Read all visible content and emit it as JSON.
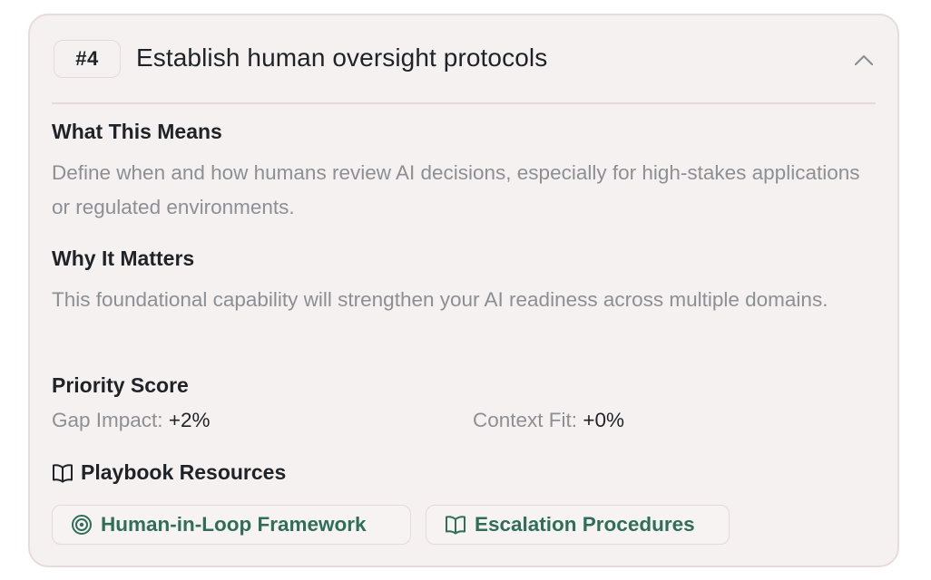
{
  "card": {
    "rank": "#4",
    "title": "Establish human oversight protocols"
  },
  "what_this_means": {
    "heading": "What This Means",
    "body": "Define when and how humans review AI decisions, especially for high-stakes applications or regulated environments."
  },
  "why_it_matters": {
    "heading": "Why It Matters",
    "body": "This foundational capability will strengthen your AI readiness across multiple domains."
  },
  "priority_score": {
    "heading": "Priority Score",
    "gap_impact_label": "Gap Impact:",
    "gap_impact_value": "+2%",
    "context_fit_label": "Context Fit:",
    "context_fit_value": "+0%"
  },
  "playbook": {
    "heading": "Playbook Resources",
    "icon": "book-open-icon",
    "resources": [
      {
        "label": "Human-in-Loop Framework",
        "icon": "target-icon"
      },
      {
        "label": "Escalation Procedures",
        "icon": "book-open-icon"
      }
    ]
  },
  "colors": {
    "card_bg": "#f5f1f0",
    "border": "#e6dcdb",
    "muted_text": "#8c8f94",
    "heading_text": "#1f2328",
    "link_green": "#2e6e5a"
  }
}
